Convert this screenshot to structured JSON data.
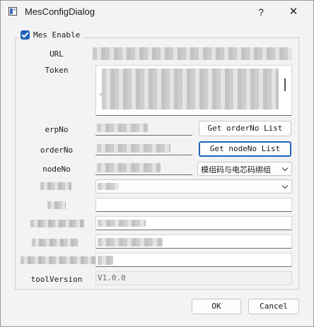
{
  "window": {
    "title": "MesConfigDialog",
    "help_label": "?",
    "close_label": "✕"
  },
  "group": {
    "checkbox_label": "Mes Enable",
    "checked": true
  },
  "fields": {
    "url_label": "URL",
    "token_label": "Token",
    "erpno_label": "erpNo",
    "orderno_label": "orderNo",
    "nodeno_label": "nodeNo",
    "toolversion_label": "toolVersion",
    "toolversion_value": "V1.0.0"
  },
  "buttons": {
    "get_order_list": "Get orderNo List",
    "get_node_list": "Get nodeNo List",
    "ok": "OK",
    "cancel": "Cancel"
  },
  "combos": {
    "node_type": "模组码与电芯码绑组"
  },
  "icons": {
    "app": "window-app-icon",
    "checkbox": "checkmark-icon",
    "dropdown": "chevron-down-icon"
  }
}
